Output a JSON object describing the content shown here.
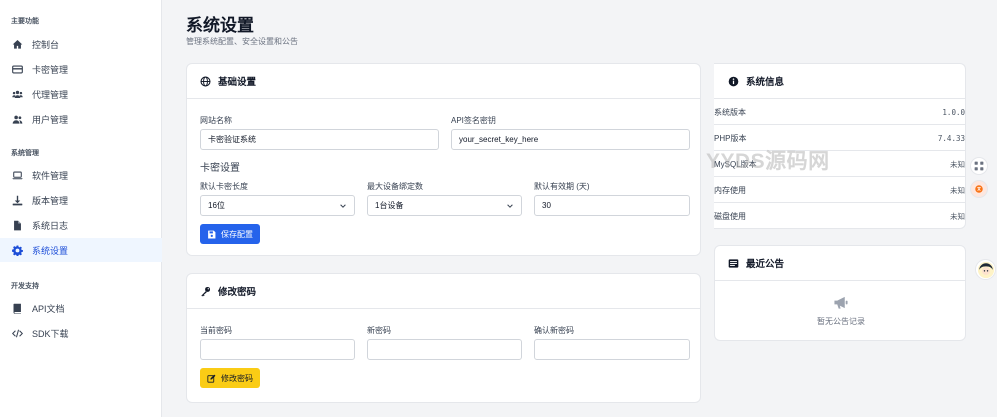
{
  "sidebar": {
    "sections": [
      {
        "title": "主要功能"
      },
      {
        "title": "系统管理"
      },
      {
        "title": "开发支持"
      }
    ],
    "items": [
      {
        "label": "控制台",
        "icon": "home-icon"
      },
      {
        "label": "卡密管理",
        "icon": "credit-card-icon"
      },
      {
        "label": "代理管理",
        "icon": "users-group-icon"
      },
      {
        "label": "用户管理",
        "icon": "users-icon"
      },
      {
        "label": "软件管理",
        "icon": "laptop-icon"
      },
      {
        "label": "版本管理",
        "icon": "download-icon"
      },
      {
        "label": "系统日志",
        "icon": "file-icon"
      },
      {
        "label": "系统设置",
        "icon": "gear-icon",
        "active": true
      },
      {
        "label": "API文档",
        "icon": "book-icon"
      },
      {
        "label": "SDK下载",
        "icon": "code-icon"
      }
    ]
  },
  "header": {
    "title": "系统设置",
    "subtitle": "管理系统配置、安全设置和公告"
  },
  "basic": {
    "title": "基础设置",
    "site_name_label": "网站名称",
    "site_name_value": "卡密验证系统",
    "api_key_label": "API签名密钥",
    "api_key_value": "your_secret_key_here",
    "card_section_title": "卡密设置",
    "card_length_label": "默认卡密长度",
    "card_length_value": "16位",
    "max_devices_label": "最大设备绑定数",
    "max_devices_value": "1台设备",
    "validity_label": "默认有效期 (天)",
    "validity_value": "30",
    "save_button": "保存配置"
  },
  "password": {
    "title": "修改密码",
    "current_label": "当前密码",
    "new_label": "新密码",
    "confirm_label": "确认新密码",
    "submit_button": "修改密码"
  },
  "system_info": {
    "title": "系统信息",
    "rows": [
      {
        "label": "系统版本",
        "value": "1.0.0"
      },
      {
        "label": "PHP版本",
        "value": "7.4.33"
      },
      {
        "label": "MySQL版本",
        "value": "未知"
      },
      {
        "label": "内存使用",
        "value": "未知"
      },
      {
        "label": "磁盘使用",
        "value": "未知"
      }
    ]
  },
  "announcements": {
    "title": "最近公告",
    "empty_text": "暂无公告记录"
  },
  "watermark": "YYDS源码网",
  "colors": {
    "primary": "#2563eb",
    "warning": "#facc15",
    "active_bg": "#eff6ff"
  }
}
